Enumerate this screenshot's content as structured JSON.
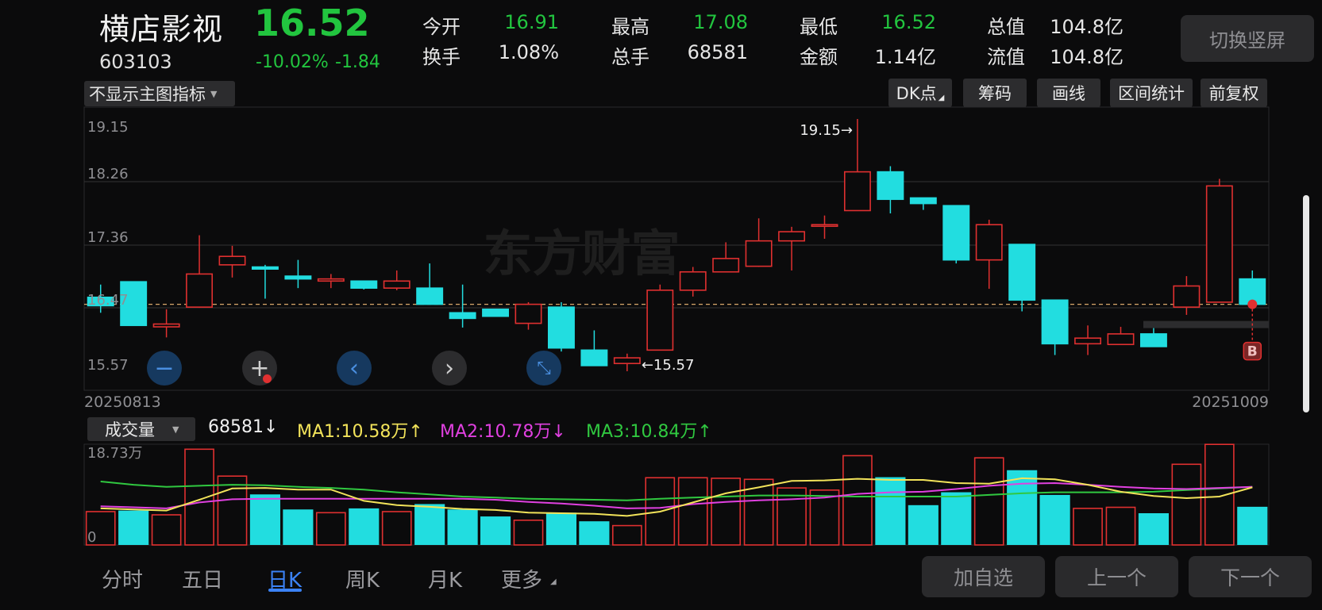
{
  "quote": {
    "name": "横店影视",
    "code": "603103",
    "price": "16.52",
    "change_pct": "-10.02%",
    "change": "-1.84",
    "stats": [
      {
        "label": "今开",
        "value": "16.91",
        "color": "green"
      },
      {
        "label": "最高",
        "value": "17.08",
        "color": "green"
      },
      {
        "label": "最低",
        "value": "16.52",
        "color": "green"
      },
      {
        "label": "总值",
        "value": "104.8亿",
        "color": "white"
      },
      {
        "label": "换手",
        "value": "1.08%",
        "color": "white"
      },
      {
        "label": "总手",
        "value": "68581",
        "color": "white"
      },
      {
        "label": "金额",
        "value": "1.14亿",
        "color": "white"
      },
      {
        "label": "流值",
        "value": "104.8亿",
        "color": "white"
      }
    ]
  },
  "toolbar": {
    "switch_label": "切换竖屏",
    "indicator_label": "不显示主图指标",
    "tools": [
      "DK点",
      "筹码",
      "画线",
      "区间统计",
      "前复权"
    ]
  },
  "chart_labels": {
    "y_ticks": [
      "19.15",
      "18.26",
      "17.36",
      "16.47",
      "15.57"
    ],
    "start_date": "20250813",
    "end_date": "20251009",
    "max_marker": "19.15→",
    "min_marker": "←15.57",
    "b_marker": "B",
    "watermark": "东方财富"
  },
  "volume": {
    "selector_label": "成交量",
    "value": "68581↓",
    "ma1": "MA1:10.58万↑",
    "ma2": "MA2:10.78万↓",
    "ma3": "MA3:10.84万↑",
    "ymax_label": "18.73万",
    "ymin_label": "0"
  },
  "tabs": [
    "分时",
    "五日",
    "日K",
    "周K",
    "月K",
    "更多"
  ],
  "active_tab": "日K",
  "bottom_buttons": [
    "加自选",
    "上一个",
    "下一个"
  ],
  "colors": {
    "up": "#e03030",
    "down": "#22dde0",
    "price_green": "#22c53f",
    "ma1": "#f2e35a",
    "ma2": "#e040e0",
    "ma3": "#30c840",
    "accent": "#3b82f6"
  },
  "chart_data": {
    "type": "candlestick",
    "y_range": [
      15.57,
      19.15
    ],
    "reference_price": 16.52,
    "candles": [
      {
        "o": 16.62,
        "h": 16.8,
        "l": 16.4,
        "c": 16.5
      },
      {
        "o": 16.84,
        "h": 16.84,
        "l": 16.22,
        "c": 16.22
      },
      {
        "o": 16.2,
        "h": 16.45,
        "l": 16.05,
        "c": 16.24
      },
      {
        "o": 16.48,
        "h": 17.5,
        "l": 16.47,
        "c": 16.95
      },
      {
        "o": 17.08,
        "h": 17.35,
        "l": 16.9,
        "c": 17.2
      },
      {
        "o": 17.05,
        "h": 17.08,
        "l": 16.6,
        "c": 17.02
      },
      {
        "o": 16.92,
        "h": 17.15,
        "l": 16.75,
        "c": 16.88
      },
      {
        "o": 16.85,
        "h": 16.95,
        "l": 16.75,
        "c": 16.88
      },
      {
        "o": 16.85,
        "h": 16.85,
        "l": 16.73,
        "c": 16.75
      },
      {
        "o": 16.75,
        "h": 17.0,
        "l": 16.72,
        "c": 16.85
      },
      {
        "o": 16.75,
        "h": 17.1,
        "l": 16.52,
        "c": 16.52
      },
      {
        "o": 16.4,
        "h": 16.8,
        "l": 16.19,
        "c": 16.32
      },
      {
        "o": 16.45,
        "h": 16.45,
        "l": 16.38,
        "c": 16.35
      },
      {
        "o": 16.25,
        "h": 16.55,
        "l": 16.16,
        "c": 16.52
      },
      {
        "o": 16.48,
        "h": 16.55,
        "l": 15.85,
        "c": 15.9
      },
      {
        "o": 15.87,
        "h": 16.15,
        "l": 15.65,
        "c": 15.65
      },
      {
        "o": 15.68,
        "h": 15.82,
        "l": 15.57,
        "c": 15.76
      },
      {
        "o": 15.87,
        "h": 16.8,
        "l": 15.87,
        "c": 16.72
      },
      {
        "o": 16.72,
        "h": 17.05,
        "l": 16.63,
        "c": 16.98
      },
      {
        "o": 16.98,
        "h": 17.4,
        "l": 16.98,
        "c": 17.17
      },
      {
        "o": 17.06,
        "h": 17.74,
        "l": 17.05,
        "c": 17.42
      },
      {
        "o": 17.42,
        "h": 17.62,
        "l": 17.0,
        "c": 17.55
      },
      {
        "o": 17.65,
        "h": 17.78,
        "l": 17.45,
        "c": 17.65
      },
      {
        "o": 17.85,
        "h": 19.15,
        "l": 17.85,
        "c": 18.4
      },
      {
        "o": 18.4,
        "h": 18.48,
        "l": 17.81,
        "c": 18.01
      },
      {
        "o": 18.03,
        "h": 18.03,
        "l": 17.86,
        "c": 17.95
      },
      {
        "o": 17.92,
        "h": 17.92,
        "l": 17.1,
        "c": 17.15
      },
      {
        "o": 17.15,
        "h": 17.72,
        "l": 16.74,
        "c": 17.65
      },
      {
        "o": 17.37,
        "h": 17.37,
        "l": 16.42,
        "c": 16.58
      },
      {
        "o": 16.58,
        "h": 16.58,
        "l": 15.8,
        "c": 15.96
      },
      {
        "o": 15.96,
        "h": 16.22,
        "l": 15.8,
        "c": 16.04
      },
      {
        "o": 15.95,
        "h": 16.2,
        "l": 15.95,
        "c": 16.1
      },
      {
        "o": 16.1,
        "h": 16.2,
        "l": 15.92,
        "c": 15.92
      },
      {
        "o": 16.48,
        "h": 16.92,
        "l": 16.37,
        "c": 16.78
      },
      {
        "o": 16.55,
        "h": 18.3,
        "l": 16.55,
        "c": 18.2
      },
      {
        "o": 16.88,
        "h": 17.0,
        "l": 16.55,
        "c": 16.52
      }
    ],
    "volume_ymax": 18.73,
    "volumes": [
      {
        "v": 6.2,
        "up": true
      },
      {
        "v": 6.4,
        "up": false
      },
      {
        "v": 5.6,
        "up": true
      },
      {
        "v": 17.8,
        "up": true
      },
      {
        "v": 12.8,
        "up": true
      },
      {
        "v": 9.4,
        "up": false
      },
      {
        "v": 6.6,
        "up": false
      },
      {
        "v": 6.0,
        "up": true
      },
      {
        "v": 6.8,
        "up": false
      },
      {
        "v": 6.2,
        "up": true
      },
      {
        "v": 7.6,
        "up": false
      },
      {
        "v": 6.6,
        "up": false
      },
      {
        "v": 5.3,
        "up": false
      },
      {
        "v": 4.6,
        "up": true
      },
      {
        "v": 6.0,
        "up": false
      },
      {
        "v": 4.4,
        "up": false
      },
      {
        "v": 3.6,
        "up": true
      },
      {
        "v": 12.5,
        "up": true
      },
      {
        "v": 12.5,
        "up": true
      },
      {
        "v": 12.4,
        "up": true
      },
      {
        "v": 12.2,
        "up": true
      },
      {
        "v": 10.6,
        "up": true
      },
      {
        "v": 10.2,
        "up": true
      },
      {
        "v": 16.6,
        "up": true
      },
      {
        "v": 12.6,
        "up": false
      },
      {
        "v": 7.4,
        "up": false
      },
      {
        "v": 9.8,
        "up": false
      },
      {
        "v": 16.2,
        "up": true
      },
      {
        "v": 13.9,
        "up": false
      },
      {
        "v": 9.3,
        "up": false
      },
      {
        "v": 6.8,
        "up": true
      },
      {
        "v": 7.0,
        "up": true
      },
      {
        "v": 5.9,
        "up": false
      },
      {
        "v": 15.0,
        "up": true
      },
      {
        "v": 18.7,
        "up": true
      },
      {
        "v": 7.1,
        "up": false
      }
    ],
    "ma1": [
      6.8,
      6.6,
      6.4,
      8.4,
      10.5,
      10.6,
      10.3,
      10.3,
      8.2,
      7.4,
      7.1,
      6.7,
      6.5,
      6.0,
      5.9,
      5.8,
      5.4,
      6.2,
      7.9,
      9.6,
      10.7,
      11.9,
      12.0,
      12.3,
      12.1,
      12.1,
      11.5,
      11.4,
      12.4,
      12.2,
      11.2,
      9.9,
      9.1,
      8.7,
      9.0,
      10.7
    ],
    "ma2": [
      7.2,
      7.0,
      6.8,
      7.9,
      8.5,
      8.6,
      8.6,
      8.6,
      8.6,
      8.6,
      8.6,
      8.6,
      8.4,
      8.0,
      7.7,
      7.3,
      6.8,
      6.9,
      7.6,
      8.0,
      8.3,
      8.5,
      8.8,
      9.5,
      9.8,
      9.9,
      10.4,
      11.0,
      11.4,
      11.5,
      11.2,
      10.8,
      10.5,
      10.4,
      10.6,
      10.8
    ],
    "ma3": [
      11.8,
      11.2,
      10.8,
      11.0,
      11.2,
      11.1,
      10.8,
      10.6,
      10.3,
      9.8,
      9.4,
      9.0,
      8.8,
      8.6,
      8.5,
      8.4,
      8.3,
      8.6,
      8.8,
      9.0,
      9.2,
      9.2,
      9.1,
      9.0,
      9.0,
      9.0,
      9.0,
      9.3,
      9.6,
      9.8,
      9.8,
      9.8,
      9.9,
      10.2,
      10.5,
      10.8
    ]
  }
}
